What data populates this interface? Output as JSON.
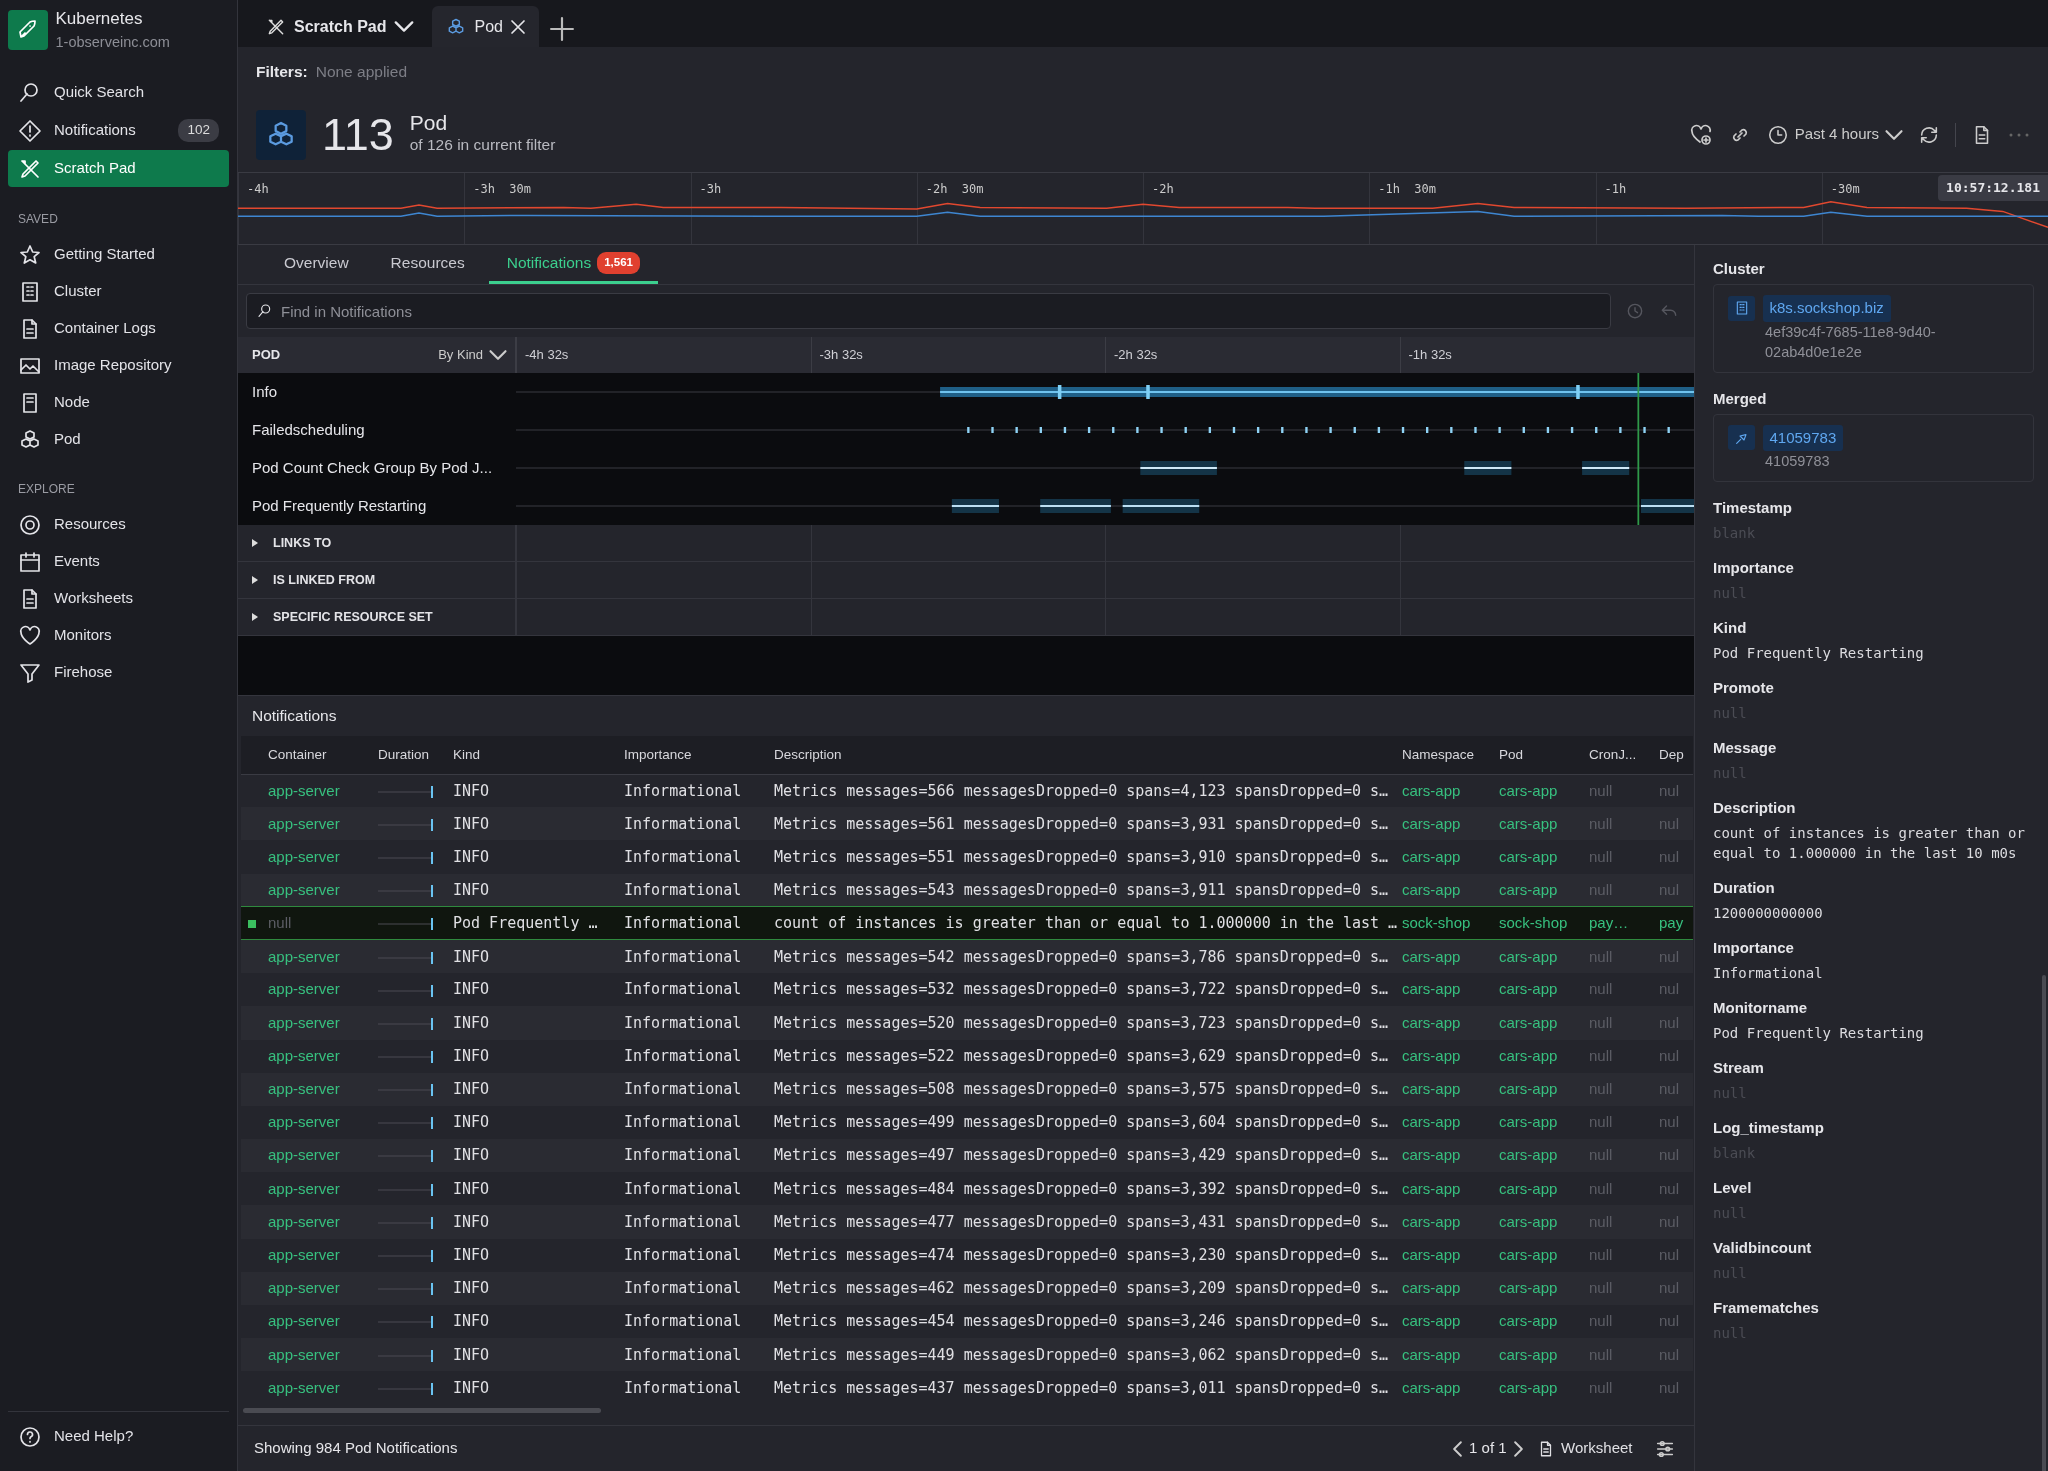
{
  "sidebar": {
    "brand": {
      "title": "Kubernetes",
      "subtitle": "1-observeinc.com"
    },
    "top_items": [
      {
        "label": "Quick Search",
        "selected": false
      },
      {
        "label": "Notifications",
        "badge": "102",
        "selected": false
      },
      {
        "label": "Scratch Pad",
        "selected": true
      }
    ],
    "sections": [
      {
        "title": "SAVED",
        "items": [
          {
            "label": "Getting Started"
          },
          {
            "label": "Cluster"
          },
          {
            "label": "Container Logs"
          },
          {
            "label": "Image Repository"
          },
          {
            "label": "Node"
          },
          {
            "label": "Pod"
          }
        ]
      },
      {
        "title": "EXPLORE",
        "items": [
          {
            "label": "Resources"
          },
          {
            "label": "Events"
          },
          {
            "label": "Worksheets"
          },
          {
            "label": "Monitors"
          },
          {
            "label": "Firehose"
          }
        ]
      }
    ],
    "help": "Need Help?"
  },
  "tabs": [
    {
      "label": "Scratch Pad",
      "kind": "menu",
      "selected": false
    },
    {
      "label": "Pod",
      "kind": "closable",
      "selected": true
    }
  ],
  "filters": {
    "label": "Filters:",
    "value": "None applied"
  },
  "header": {
    "count": "113",
    "title": "Pod",
    "subtitle": "of 126 in current filter",
    "time_range": "Past 4 hours"
  },
  "overview": {
    "ticks": [
      "-4h",
      "-3h  30m",
      "-3h",
      "-2h  30m",
      "-2h",
      "-1h  30m",
      "-1h",
      "-30m"
    ],
    "cursor_time": "10:57:12.181"
  },
  "view_tabs": [
    {
      "label": "Overview",
      "selected": false
    },
    {
      "label": "Resources",
      "selected": false
    },
    {
      "label": "Notifications",
      "badge": "1,561",
      "selected": true
    }
  ],
  "search": {
    "placeholder": "Find in Notifications"
  },
  "timeline": {
    "group_label": "POD",
    "group_by": "By Kind",
    "ticks": [
      "-4h 32s",
      "-3h 32s",
      "-2h 32s",
      "-1h 32s"
    ],
    "lanes": [
      {
        "label": "Info",
        "kind": "dense"
      },
      {
        "label": "Failedscheduling",
        "kind": "ticks"
      },
      {
        "label": "Pod Count Check Group By Pod J...",
        "kind": "blocks"
      },
      {
        "label": "Pod Frequently Restarting",
        "kind": "spans"
      }
    ],
    "groups": [
      {
        "label": "LINKS TO",
        "expanded": false
      },
      {
        "label": "IS LINKED FROM",
        "expanded": false
      },
      {
        "label": "SPECIFIC RESOURCE SET",
        "expanded": false
      }
    ]
  },
  "notifications": {
    "title": "Notifications",
    "columns": [
      "Container",
      "Duration",
      "Kind",
      "Importance",
      "Description",
      "Namespace",
      "Pod",
      "CronJ...",
      "Dep"
    ],
    "rows": [
      {
        "kind": "metric",
        "selected": false,
        "cells": [
          "app-server",
          "",
          "INFO",
          "Informational",
          "Metrics messages=566 messagesDropped=0 spans=4,123 spansDropped=0 s…",
          "cars-app",
          "cars-app",
          "null",
          "nul"
        ]
      },
      {
        "kind": "metric",
        "selected": false,
        "cells": [
          "app-server",
          "",
          "INFO",
          "Informational",
          "Metrics messages=561 messagesDropped=0 spans=3,931 spansDropped=0 s…",
          "cars-app",
          "cars-app",
          "null",
          "nul"
        ]
      },
      {
        "kind": "metric",
        "selected": false,
        "cells": [
          "app-server",
          "",
          "INFO",
          "Informational",
          "Metrics messages=551 messagesDropped=0 spans=3,910 spansDropped=0 s…",
          "cars-app",
          "cars-app",
          "null",
          "nul"
        ]
      },
      {
        "kind": "metric",
        "selected": false,
        "cells": [
          "app-server",
          "",
          "INFO",
          "Informational",
          "Metrics messages=543 messagesDropped=0 spans=3,911 spansDropped=0 s…",
          "cars-app",
          "cars-app",
          "null",
          "nul"
        ]
      },
      {
        "kind": "monitor",
        "selected": true,
        "cells": [
          "null",
          "",
          "Pod Frequently …",
          "Informational",
          "count of instances is greater than or equal to 1.000000 in the last …",
          "sock-shop",
          "sock-shop",
          "pay…",
          "pay"
        ]
      },
      {
        "kind": "metric",
        "selected": false,
        "cells": [
          "app-server",
          "",
          "INFO",
          "Informational",
          "Metrics messages=542 messagesDropped=0 spans=3,786 spansDropped=0 s…",
          "cars-app",
          "cars-app",
          "null",
          "nul"
        ]
      },
      {
        "kind": "metric",
        "selected": false,
        "cells": [
          "app-server",
          "",
          "INFO",
          "Informational",
          "Metrics messages=532 messagesDropped=0 spans=3,722 spansDropped=0 s…",
          "cars-app",
          "cars-app",
          "null",
          "nul"
        ]
      },
      {
        "kind": "metric",
        "selected": false,
        "cells": [
          "app-server",
          "",
          "INFO",
          "Informational",
          "Metrics messages=520 messagesDropped=0 spans=3,723 spansDropped=0 s…",
          "cars-app",
          "cars-app",
          "null",
          "nul"
        ]
      },
      {
        "kind": "metric",
        "selected": false,
        "cells": [
          "app-server",
          "",
          "INFO",
          "Informational",
          "Metrics messages=522 messagesDropped=0 spans=3,629 spansDropped=0 s…",
          "cars-app",
          "cars-app",
          "null",
          "nul"
        ]
      },
      {
        "kind": "metric",
        "selected": false,
        "cells": [
          "app-server",
          "",
          "INFO",
          "Informational",
          "Metrics messages=508 messagesDropped=0 spans=3,575 spansDropped=0 s…",
          "cars-app",
          "cars-app",
          "null",
          "nul"
        ]
      },
      {
        "kind": "metric",
        "selected": false,
        "cells": [
          "app-server",
          "",
          "INFO",
          "Informational",
          "Metrics messages=499 messagesDropped=0 spans=3,604 spansDropped=0 s…",
          "cars-app",
          "cars-app",
          "null",
          "nul"
        ]
      },
      {
        "kind": "metric",
        "selected": false,
        "cells": [
          "app-server",
          "",
          "INFO",
          "Informational",
          "Metrics messages=497 messagesDropped=0 spans=3,429 spansDropped=0 s…",
          "cars-app",
          "cars-app",
          "null",
          "nul"
        ]
      },
      {
        "kind": "metric",
        "selected": false,
        "cells": [
          "app-server",
          "",
          "INFO",
          "Informational",
          "Metrics messages=484 messagesDropped=0 spans=3,392 spansDropped=0 s…",
          "cars-app",
          "cars-app",
          "null",
          "nul"
        ]
      },
      {
        "kind": "metric",
        "selected": false,
        "cells": [
          "app-server",
          "",
          "INFO",
          "Informational",
          "Metrics messages=477 messagesDropped=0 spans=3,431 spansDropped=0 s…",
          "cars-app",
          "cars-app",
          "null",
          "nul"
        ]
      },
      {
        "kind": "metric",
        "selected": false,
        "cells": [
          "app-server",
          "",
          "INFO",
          "Informational",
          "Metrics messages=474 messagesDropped=0 spans=3,230 spansDropped=0 s…",
          "cars-app",
          "cars-app",
          "null",
          "nul"
        ]
      },
      {
        "kind": "metric",
        "selected": false,
        "cells": [
          "app-server",
          "",
          "INFO",
          "Informational",
          "Metrics messages=462 messagesDropped=0 spans=3,209 spansDropped=0 s…",
          "cars-app",
          "cars-app",
          "null",
          "nul"
        ]
      },
      {
        "kind": "metric",
        "selected": false,
        "cells": [
          "app-server",
          "",
          "INFO",
          "Informational",
          "Metrics messages=454 messagesDropped=0 spans=3,246 spansDropped=0 s…",
          "cars-app",
          "cars-app",
          "null",
          "nul"
        ]
      },
      {
        "kind": "metric",
        "selected": false,
        "cells": [
          "app-server",
          "",
          "INFO",
          "Informational",
          "Metrics messages=449 messagesDropped=0 spans=3,062 spansDropped=0 s…",
          "cars-app",
          "cars-app",
          "null",
          "nul"
        ]
      },
      {
        "kind": "metric",
        "selected": false,
        "cells": [
          "app-server",
          "",
          "INFO",
          "Informational",
          "Metrics messages=437 messagesDropped=0 spans=3,011 spansDropped=0 s…",
          "cars-app",
          "cars-app",
          "null",
          "nul"
        ]
      }
    ],
    "footer": "Showing 984 Pod Notifications",
    "pager": "1 of 1",
    "worksheet": "Worksheet"
  },
  "details": [
    {
      "kind": "link",
      "label": "Cluster",
      "chip": "k8s.sockshop.biz",
      "value": "4ef39c4f-7685-11e8-9d40-02ab4d0e1e2e"
    },
    {
      "kind": "link",
      "label": "Merged",
      "chip": "41059783",
      "value": "41059783"
    },
    {
      "kind": "empty",
      "label": "Timestamp",
      "value": "blank"
    },
    {
      "kind": "empty",
      "label": "Importance",
      "value": "null"
    },
    {
      "kind": "text",
      "label": "Kind",
      "value": "Pod Frequently Restarting"
    },
    {
      "kind": "empty",
      "label": "Promote",
      "value": "null"
    },
    {
      "kind": "empty",
      "label": "Message",
      "value": "null"
    },
    {
      "kind": "text",
      "label": "Description",
      "value": "count of instances is greater than or equal to 1.000000 in the last 10 m0s"
    },
    {
      "kind": "text",
      "label": "Duration",
      "value": "1200000000000"
    },
    {
      "kind": "text",
      "label": "Importance",
      "value": "Informational"
    },
    {
      "kind": "text",
      "label": "Monitorname",
      "value": "Pod Frequently Restarting"
    },
    {
      "kind": "empty",
      "label": "Stream",
      "value": "null"
    },
    {
      "kind": "empty",
      "label": "Log_timestamp",
      "value": "blank"
    },
    {
      "kind": "empty",
      "label": "Level",
      "value": "null"
    },
    {
      "kind": "empty",
      "label": "Validbincount",
      "value": "null"
    },
    {
      "kind": "empty",
      "label": "Framematches",
      "value": "null"
    }
  ]
}
